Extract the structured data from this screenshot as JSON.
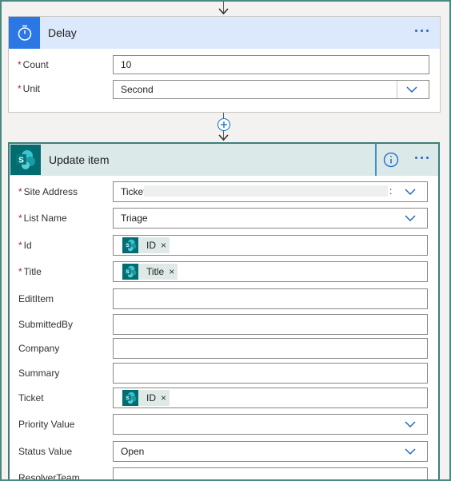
{
  "delay": {
    "title": "Delay",
    "icon": "timer-icon",
    "fields": [
      {
        "label": "Count",
        "required": true,
        "value": "10"
      },
      {
        "label": "Unit",
        "required": true,
        "value": "Second"
      }
    ]
  },
  "update_item": {
    "title": "Update item",
    "icon": "sharepoint-icon",
    "fields": [
      {
        "label": "Site Address",
        "required": true,
        "value": "Ticket",
        "suffix": ":"
      },
      {
        "label": "List Name",
        "required": true,
        "value": "Triage"
      },
      {
        "label": "Id",
        "required": true,
        "token": "ID"
      },
      {
        "label": "Title",
        "required": true,
        "token": "Title"
      },
      {
        "label": "EditItem",
        "required": false
      },
      {
        "label": "SubmittedBy",
        "required": false
      },
      {
        "label": "Company",
        "required": false
      },
      {
        "label": "Summary",
        "required": false
      },
      {
        "label": "Ticket",
        "required": false,
        "token": "ID"
      },
      {
        "label": "Priority Value",
        "required": false
      },
      {
        "label": "Status Value",
        "required": false,
        "value": "Open"
      },
      {
        "label": "ResolverTeam",
        "required": false
      }
    ]
  },
  "required_marker": "*",
  "token_close": "×",
  "colors": {
    "accent": "#2266c4",
    "sharepoint": "#036c70",
    "delay_blue": "#2b78e4"
  }
}
